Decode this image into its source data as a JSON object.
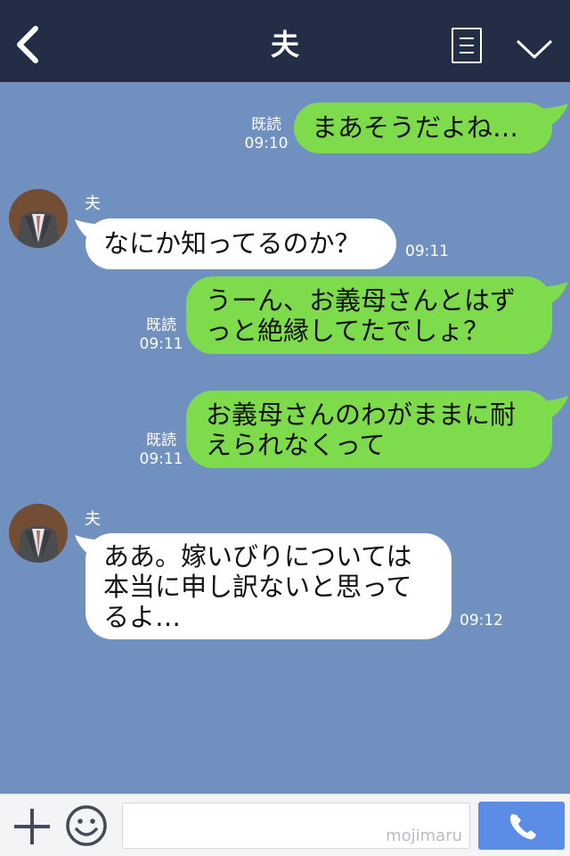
{
  "header": {
    "title": "夫"
  },
  "messages": [
    {
      "side": "right",
      "text": "まあそうだよね…",
      "read": "既読",
      "time": "09:10"
    },
    {
      "side": "left",
      "sender": "夫",
      "text": "なにか知ってるのか？",
      "time": "09:11"
    },
    {
      "side": "right",
      "text": "うーん、お義母さんとはず\nっと絶縁してたでしょ？",
      "read": "既読",
      "time": "09:11"
    },
    {
      "side": "right",
      "text": "お義母さんのわがままに耐\nえられなくって",
      "read": "既読",
      "time": "09:11"
    },
    {
      "side": "left",
      "sender": "夫",
      "text": "ああ。嫁いびりについては\n本当に申し訳ないと思って\nるよ…",
      "time": "09:12"
    }
  ],
  "footer": {
    "watermark": "mojimaru"
  }
}
